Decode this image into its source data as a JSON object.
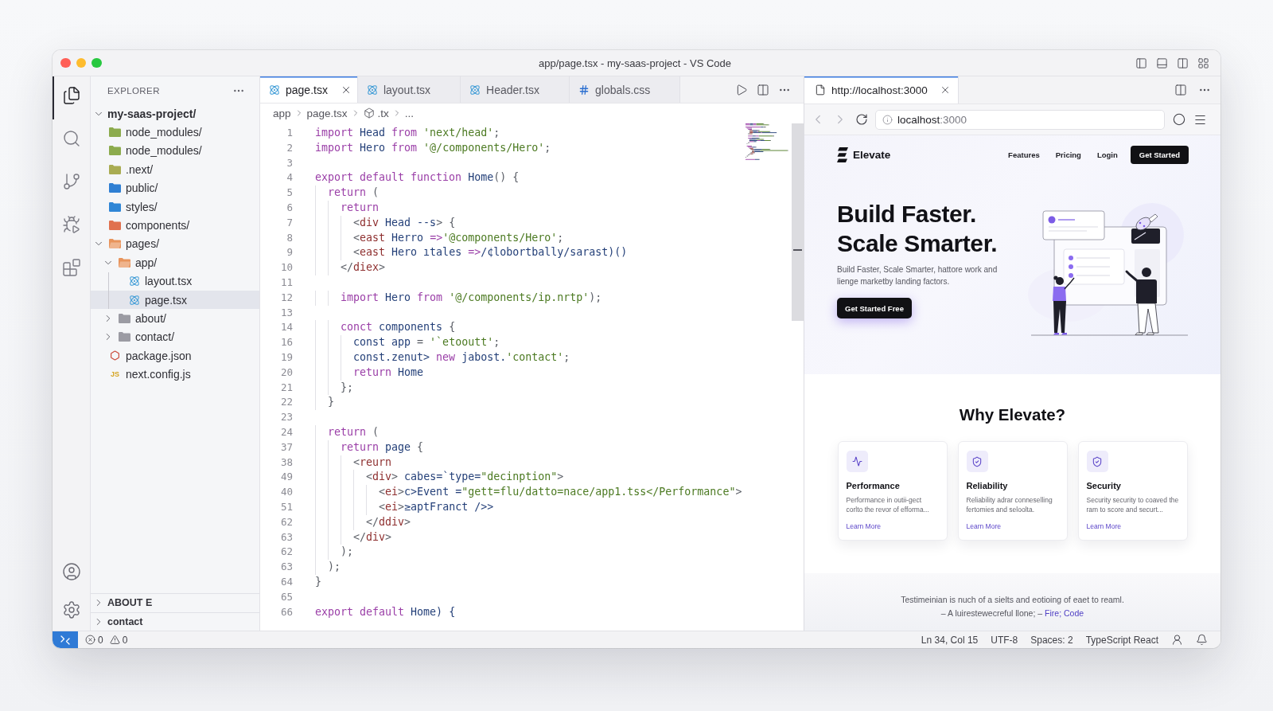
{
  "window": {
    "title": "app/page.tsx - my-saas-project - VS Code"
  },
  "activity_bar": {
    "items": [
      {
        "kind": "explorer",
        "selected": true
      },
      {
        "kind": "search",
        "selected": false
      },
      {
        "kind": "source-control",
        "selected": false
      },
      {
        "kind": "run",
        "selected": false
      },
      {
        "kind": "extensions",
        "selected": false
      }
    ]
  },
  "sidebar": {
    "title": "EXPLORER",
    "root": {
      "name": "my-saas-project/",
      "expanded": true,
      "children": [
        {
          "name": "node_modules/",
          "kind": "folder",
          "color": "#8cab4d",
          "selected": false
        },
        {
          "name": "node_modules/",
          "kind": "folder",
          "color": "#8cab4d",
          "selected": false
        },
        {
          "name": ".next/",
          "kind": "folder",
          "color": "#a9ac52",
          "selected": false
        },
        {
          "name": "public/",
          "kind": "folder",
          "color": "#2f7fd3",
          "selected": false
        },
        {
          "name": "styles/",
          "kind": "folder",
          "color": "#2f86d6",
          "selected": false
        },
        {
          "name": "components/",
          "kind": "folder",
          "color": "#e0714f",
          "selected": false
        },
        {
          "name": "pages/",
          "kind": "folder",
          "color": "#e8945c",
          "expanded": true,
          "selected": false,
          "children": [
            {
              "name": "app/",
              "kind": "folder",
              "color": "#e8945c",
              "expanded": true,
              "selected": false,
              "children": [
                {
                  "name": "layout.tsx",
                  "kind": "react",
                  "selected": false
                },
                {
                  "name": "page.tsx",
                  "kind": "react",
                  "selected": true
                }
              ]
            },
            {
              "name": "about/",
              "kind": "folder",
              "color": "#9b9ba3",
              "expanded": false,
              "selected": false
            },
            {
              "name": "contact/",
              "kind": "folder",
              "color": "#9b9ba3",
              "expanded": false,
              "selected": false
            }
          ]
        },
        {
          "name": "package.json",
          "kind": "npm",
          "selected": false
        },
        {
          "name": "next.config.js",
          "kind": "js",
          "icon_text": "JS",
          "selected": false
        }
      ]
    },
    "sections": [
      {
        "title": "ABOUT E",
        "expanded": false
      },
      {
        "title": "contact",
        "expanded": false
      }
    ]
  },
  "editor": {
    "tabs": [
      {
        "label": "page.tsx",
        "kind": "react",
        "selected": true
      },
      {
        "label": "layout.tsx",
        "kind": "react",
        "selected": false
      },
      {
        "label": "Header.tsx",
        "kind": "react",
        "selected": false
      },
      {
        "label": "globals.css",
        "kind": "css",
        "selected": false
      }
    ],
    "breadcrumbs": [
      {
        "label": "app",
        "kind": "path"
      },
      {
        "label": "page.tsx",
        "kind": "path"
      },
      {
        "label": ".tx",
        "kind": "symbol"
      },
      {
        "label": "...",
        "kind": "path"
      }
    ],
    "lines": [
      {
        "number": "1",
        "tokens": [
          {
            "text": "import ",
            "kind": "keyword"
          },
          {
            "text": "Head ",
            "kind": "name"
          },
          {
            "text": "from ",
            "kind": "keyword"
          },
          {
            "text": "'next/head'",
            "kind": "string"
          },
          {
            "text": ";",
            "kind": "punct"
          }
        ]
      },
      {
        "number": "2",
        "tokens": [
          {
            "text": "import ",
            "kind": "keyword"
          },
          {
            "text": "Hero ",
            "kind": "name"
          },
          {
            "text": "from ",
            "kind": "keyword"
          },
          {
            "text": "'@/components/Hero'",
            "kind": "string"
          },
          {
            "text": ";",
            "kind": "punct"
          }
        ]
      },
      {
        "number": "3"
      },
      {
        "number": "4",
        "tokens": [
          {
            "text": "export default function ",
            "kind": "keyword"
          },
          {
            "text": "Home",
            "kind": "name"
          },
          {
            "text": "() {",
            "kind": "punct"
          }
        ]
      },
      {
        "number": "5",
        "tokens": [
          {
            "text": "  return ",
            "kind": "keyword"
          },
          {
            "text": "(",
            "kind": "punct"
          }
        ]
      },
      {
        "number": "6",
        "tokens": [
          {
            "text": "    return",
            "kind": "keyword"
          }
        ]
      },
      {
        "number": "7",
        "tokens": [
          {
            "text": "      <",
            "kind": "punct"
          },
          {
            "text": "div ",
            "kind": "tag"
          },
          {
            "text": "Head --s",
            "kind": "name"
          },
          {
            "text": "> {",
            "kind": "punct"
          }
        ]
      },
      {
        "number": "8",
        "tokens": [
          {
            "text": "      <",
            "kind": "punct"
          },
          {
            "text": "east ",
            "kind": "tag"
          },
          {
            "text": "Herro ",
            "kind": "name"
          },
          {
            "text": "=>",
            "kind": "keyword"
          },
          {
            "text": "'@components/Hero'",
            "kind": "string"
          },
          {
            "text": ";",
            "kind": "punct"
          }
        ]
      },
      {
        "number": "9",
        "tokens": [
          {
            "text": "      <",
            "kind": "punct"
          },
          {
            "text": "east ",
            "kind": "tag"
          },
          {
            "text": "Hero ıtales ",
            "kind": "name"
          },
          {
            "text": "=>",
            "kind": "keyword"
          },
          {
            "text": "/¢lobortbally/sarast)()",
            "kind": "name"
          }
        ]
      },
      {
        "number": "10",
        "tokens": [
          {
            "text": "    </",
            "kind": "punct"
          },
          {
            "text": "diex",
            "kind": "tag"
          },
          {
            "text": ">",
            "kind": "punct"
          }
        ]
      },
      {
        "number": "11"
      },
      {
        "number": "12",
        "tokens": [
          {
            "text": "    import ",
            "kind": "keyword"
          },
          {
            "text": "Hero ",
            "kind": "name"
          },
          {
            "text": "from ",
            "kind": "keyword"
          },
          {
            "text": "'@/components/ip.nrtp'",
            "kind": "string"
          },
          {
            "text": ");",
            "kind": "punct"
          }
        ]
      },
      {
        "number": "13"
      },
      {
        "number": "14",
        "tokens": [
          {
            "text": "    conct ",
            "kind": "keyword"
          },
          {
            "text": "components ",
            "kind": "name"
          },
          {
            "text": "{",
            "kind": "punct"
          }
        ]
      },
      {
        "number": "16",
        "tokens": [
          {
            "text": "      const app ",
            "kind": "name"
          },
          {
            "text": "= ",
            "kind": "punct"
          },
          {
            "text": "'`etooutt'",
            "kind": "string"
          },
          {
            "text": ";",
            "kind": "punct"
          }
        ]
      },
      {
        "number": "19",
        "tokens": [
          {
            "text": "      const.zenut> ",
            "kind": "name"
          },
          {
            "text": "new ",
            "kind": "keyword"
          },
          {
            "text": "jabost.",
            "kind": "name"
          },
          {
            "text": "'contact'",
            "kind": "string"
          },
          {
            "text": ";",
            "kind": "punct"
          }
        ]
      },
      {
        "number": "20",
        "tokens": [
          {
            "text": "      return ",
            "kind": "keyword"
          },
          {
            "text": "Home",
            "kind": "name"
          }
        ]
      },
      {
        "number": "21",
        "tokens": [
          {
            "text": "    };",
            "kind": "punct"
          }
        ]
      },
      {
        "number": "22",
        "tokens": [
          {
            "text": "  }",
            "kind": "punct"
          }
        ]
      },
      {
        "number": "23"
      },
      {
        "number": "24",
        "tokens": [
          {
            "text": "  return ",
            "kind": "keyword"
          },
          {
            "text": "(",
            "kind": "punct"
          }
        ]
      },
      {
        "number": "37",
        "tokens": [
          {
            "text": "    return ",
            "kind": "keyword"
          },
          {
            "text": "page ",
            "kind": "name"
          },
          {
            "text": "{",
            "kind": "punct"
          }
        ]
      },
      {
        "number": "38",
        "tokens": [
          {
            "text": "      <",
            "kind": "punct"
          },
          {
            "text": "reurn",
            "kind": "tag"
          }
        ]
      },
      {
        "number": "49",
        "tokens": [
          {
            "text": "        <",
            "kind": "punct"
          },
          {
            "text": "div",
            "kind": "tag"
          },
          {
            "text": "> ",
            "kind": "punct"
          },
          {
            "text": "cabes=`type=",
            "kind": "name"
          },
          {
            "text": "\"decinption\"",
            "kind": "string"
          },
          {
            "text": ">",
            "kind": "punct"
          }
        ]
      },
      {
        "number": "40",
        "tokens": [
          {
            "text": "          <",
            "kind": "punct"
          },
          {
            "text": "ei",
            "kind": "tag"
          },
          {
            "text": ">",
            "kind": "punct"
          },
          {
            "text": "c>Event =",
            "kind": "name"
          },
          {
            "text": "\"gett=flu/datto=nace/app1.tss</Performance\"",
            "kind": "string"
          },
          {
            "text": ">",
            "kind": "punct"
          }
        ]
      },
      {
        "number": "51",
        "tokens": [
          {
            "text": "          <",
            "kind": "punct"
          },
          {
            "text": "ei",
            "kind": "tag"
          },
          {
            "text": ">",
            "kind": "punct"
          },
          {
            "text": "≥aptFranct />>",
            "kind": "name"
          }
        ]
      },
      {
        "number": "62",
        "tokens": [
          {
            "text": "        </",
            "kind": "punct"
          },
          {
            "text": "ddiv",
            "kind": "tag"
          },
          {
            "text": ">",
            "kind": "punct"
          }
        ]
      },
      {
        "number": "63",
        "tokens": [
          {
            "text": "      </",
            "kind": "punct"
          },
          {
            "text": "div",
            "kind": "tag"
          },
          {
            "text": ">",
            "kind": "punct"
          }
        ]
      },
      {
        "number": "62",
        "tokens": [
          {
            "text": "    );",
            "kind": "punct"
          }
        ]
      },
      {
        "number": "63",
        "tokens": [
          {
            "text": "  );",
            "kind": "punct"
          }
        ]
      },
      {
        "number": "64",
        "tokens": [
          {
            "text": "}",
            "kind": "punct"
          }
        ]
      },
      {
        "number": "65"
      },
      {
        "number": "66",
        "tokens": [
          {
            "text": "export default ",
            "kind": "keyword"
          },
          {
            "text": "Home) {",
            "kind": "name"
          }
        ]
      }
    ]
  },
  "browser": {
    "tabs": [
      {
        "label": "http://localhost:3000",
        "selected": true
      }
    ],
    "back": {
      "disabled": true
    },
    "forward": {
      "disabled": true
    },
    "address": {
      "host": "localhost",
      "port": ":3000"
    },
    "site": {
      "brand": "Elevate",
      "nav": [
        "Features",
        "Pricing",
        "Login"
      ],
      "nav_button": "Get Started",
      "hero": {
        "title_lines": [
          "Build Faster.",
          "Scale Smarter."
        ],
        "text": "Build Faster, Scale Smarter, hattore work and lienge marketby landing factors.",
        "button": "Get Started Free"
      },
      "features": {
        "title": "Why Elevate?",
        "cards": [
          {
            "kind": "pulse",
            "title": "Performance",
            "text": "Performance in outii-gect corlto the revor of efforma...",
            "link": "Learn More"
          },
          {
            "kind": "shield",
            "title": "Reliability",
            "text": "Reliability adrar conneselling fertomies and seloolta.",
            "link": "Learn More"
          },
          {
            "kind": "shield",
            "title": "Security",
            "text": "Security security to coaved the ram to score and securt...",
            "link": "Learn More"
          }
        ]
      },
      "testimonial": {
        "quote": "Testimeinian is nuch of a sielts and eotioing of eaet to reaml.",
        "attribution": "– A luirestewecreful llone; –",
        "link": "Fire; Code"
      }
    }
  },
  "status_bar": {
    "problems": {
      "errors": "0",
      "warnings": "0"
    },
    "items": [
      "Ln 34, Col 15",
      "UTF-8",
      "Spaces: 2",
      "TypeScript React"
    ]
  }
}
